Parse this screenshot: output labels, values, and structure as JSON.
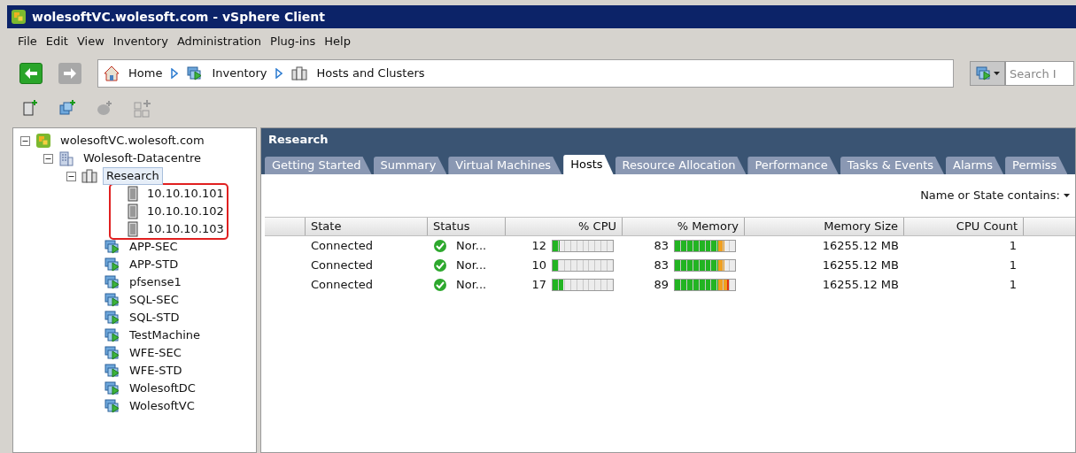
{
  "window": {
    "title": "wolesoftVC.wolesoft.com - vSphere Client"
  },
  "menu": [
    "File",
    "Edit",
    "View",
    "Inventory",
    "Administration",
    "Plug-ins",
    "Help"
  ],
  "nav": {
    "back_disabled": false,
    "forward_disabled": true,
    "breadcrumb": [
      {
        "label": "Home",
        "kind": "home"
      },
      {
        "label": "Inventory",
        "kind": "inventory"
      },
      {
        "label": "Hosts and Clusters",
        "kind": "hosts"
      }
    ],
    "search": {
      "placeholder": "Search I"
    }
  },
  "tree": [
    {
      "label": "wolesoftVC.wolesoft.com",
      "kind": "vcenter",
      "expanded": true,
      "selected": false,
      "children": [
        {
          "label": "Wolesoft-Datacentre",
          "kind": "datacenter",
          "expanded": true,
          "selected": false,
          "children": [
            {
              "label": "Research",
              "kind": "cluster",
              "expanded": true,
              "selected": true,
              "children": [
                {
                  "label": "10.10.10.101",
                  "kind": "host",
                  "highlighted": true,
                  "selected": false
                },
                {
                  "label": "10.10.10.102",
                  "kind": "host",
                  "highlighted": true,
                  "selected": false
                },
                {
                  "label": "10.10.10.103",
                  "kind": "host",
                  "highlighted": true,
                  "selected": false
                },
                {
                  "label": "APP-SEC",
                  "kind": "vm",
                  "highlighted": false,
                  "selected": false
                },
                {
                  "label": "APP-STD",
                  "kind": "vm",
                  "highlighted": false,
                  "selected": false
                },
                {
                  "label": "pfsense1",
                  "kind": "vm",
                  "highlighted": false,
                  "selected": false
                },
                {
                  "label": "SQL-SEC",
                  "kind": "vm",
                  "highlighted": false,
                  "selected": false
                },
                {
                  "label": "SQL-STD",
                  "kind": "vm",
                  "highlighted": false,
                  "selected": false
                },
                {
                  "label": "TestMachine",
                  "kind": "vm",
                  "highlighted": false,
                  "selected": false
                },
                {
                  "label": "WFE-SEC",
                  "kind": "vm",
                  "highlighted": false,
                  "selected": false
                },
                {
                  "label": "WFE-STD",
                  "kind": "vm",
                  "highlighted": false,
                  "selected": false
                },
                {
                  "label": "WolesoftDC",
                  "kind": "vm",
                  "highlighted": false,
                  "selected": false
                },
                {
                  "label": "WolesoftVC",
                  "kind": "vm",
                  "highlighted": false,
                  "selected": false
                }
              ]
            }
          ]
        }
      ]
    }
  ],
  "panel": {
    "title": "Research",
    "tabs": [
      {
        "label": "Getting Started",
        "selected": false
      },
      {
        "label": "Summary",
        "selected": false
      },
      {
        "label": "Virtual Machines",
        "selected": false
      },
      {
        "label": "Hosts",
        "selected": true
      },
      {
        "label": "Resource Allocation",
        "selected": false
      },
      {
        "label": "Performance",
        "selected": false
      },
      {
        "label": "Tasks & Events",
        "selected": false
      },
      {
        "label": "Alarms",
        "selected": false
      },
      {
        "label": "Permiss",
        "selected": false
      }
    ],
    "filter_label": "Name or State contains:",
    "table": {
      "columns": [
        "State",
        "Status",
        "% CPU",
        "% Memory",
        "Memory Size",
        "CPU Count"
      ],
      "rows": [
        {
          "state": "Connected",
          "status": "Nor...",
          "cpu": "12",
          "cpu_bar": {
            "level": 0.12
          },
          "memory": "83",
          "memory_bar": {
            "level": 0.83
          },
          "memory_size": "16255.12 MB",
          "cpu_count": "1"
        },
        {
          "state": "Connected",
          "status": "Nor...",
          "cpu": "10",
          "cpu_bar": {
            "level": 0.1
          },
          "memory": "83",
          "memory_bar": {
            "level": 0.83
          },
          "memory_size": "16255.12 MB",
          "cpu_count": "1"
        },
        {
          "state": "Connected",
          "status": "Nor...",
          "cpu": "17",
          "cpu_bar": {
            "level": 0.17
          },
          "memory": "89",
          "memory_bar": {
            "level": 0.89
          },
          "memory_size": "16255.12 MB",
          "cpu_count": "1"
        }
      ]
    }
  }
}
